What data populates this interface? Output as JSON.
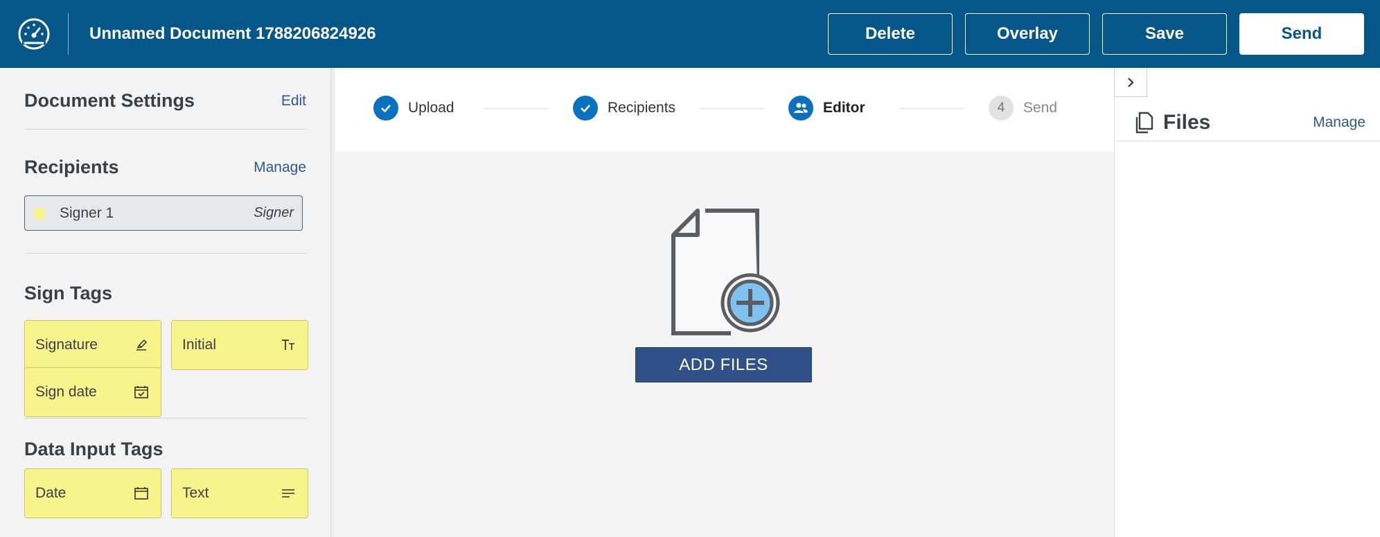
{
  "header": {
    "document_title": "Unnamed Document 1788206824926",
    "buttons": {
      "delete": "Delete",
      "overlay": "Overlay",
      "save": "Save",
      "send": "Send"
    }
  },
  "sidebar": {
    "document_settings": {
      "title": "Document Settings",
      "action": "Edit"
    },
    "recipients": {
      "title": "Recipients",
      "action": "Manage",
      "items": [
        {
          "name": "Signer 1",
          "role": "Signer",
          "color": "#f6f48a"
        }
      ]
    },
    "sign_tags": {
      "title": "Sign Tags",
      "items": [
        {
          "label": "Signature",
          "icon": "pen-icon"
        },
        {
          "label": "Initial",
          "icon": "text-size-icon"
        },
        {
          "label": "Sign date",
          "icon": "calendar-check-icon"
        }
      ]
    },
    "data_input_tags": {
      "title": "Data Input Tags",
      "items": [
        {
          "label": "Date",
          "icon": "calendar-icon"
        },
        {
          "label": "Text",
          "icon": "text-lines-icon"
        }
      ]
    }
  },
  "stepper": {
    "steps": [
      {
        "label": "Upload",
        "state": "done"
      },
      {
        "label": "Recipients",
        "state": "done"
      },
      {
        "label": "Editor",
        "state": "active"
      },
      {
        "label": "Send",
        "number": "4",
        "state": "pending"
      }
    ]
  },
  "main": {
    "add_files_label": "ADD FILES"
  },
  "right_panel": {
    "title": "Files",
    "action": "Manage"
  },
  "colors": {
    "brand": "#05578a",
    "tag": "#f6f48a",
    "step_active": "#0a70c0",
    "add_files_button": "#2f5188"
  }
}
